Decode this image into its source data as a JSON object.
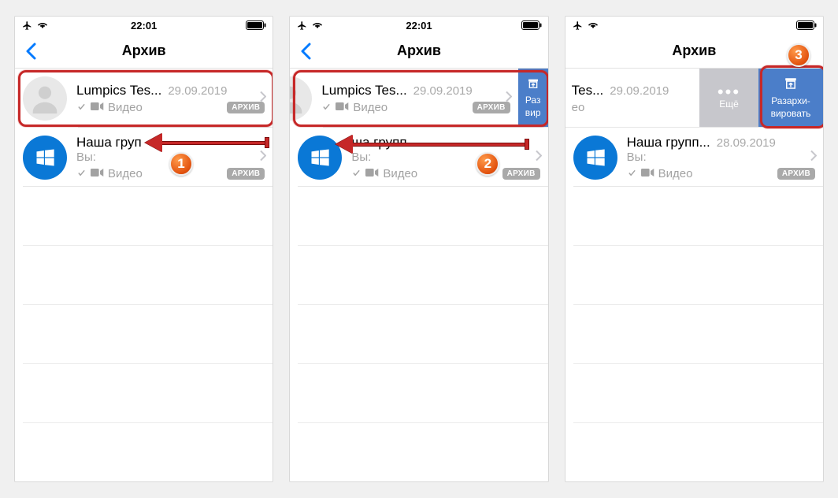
{
  "statusbar": {
    "time": "22:01"
  },
  "header": {
    "title": "Архив"
  },
  "chats": [
    {
      "name": "Lumpics Tes...",
      "date": "29.09.2019",
      "message": "Видео",
      "badge": "АРХИВ"
    },
    {
      "name": "Наша групп...",
      "name_short": "Наша груп",
      "name_cover": "ша групп",
      "date": "28.09.2019",
      "you": "Вы:",
      "message": "Видео",
      "badge": "АРХИВ"
    }
  ],
  "swipe": {
    "more": "Ещё",
    "unarchive_l1": "Разархи-",
    "unarchive_l2": "вировать",
    "unarchive_partial_l1": "Раз",
    "unarchive_partial_l2": "вир"
  },
  "screen3_row1_name": "Tes...",
  "screen3_row1_msg": "ео",
  "steps": {
    "s1": "1",
    "s2": "2",
    "s3": "3"
  }
}
